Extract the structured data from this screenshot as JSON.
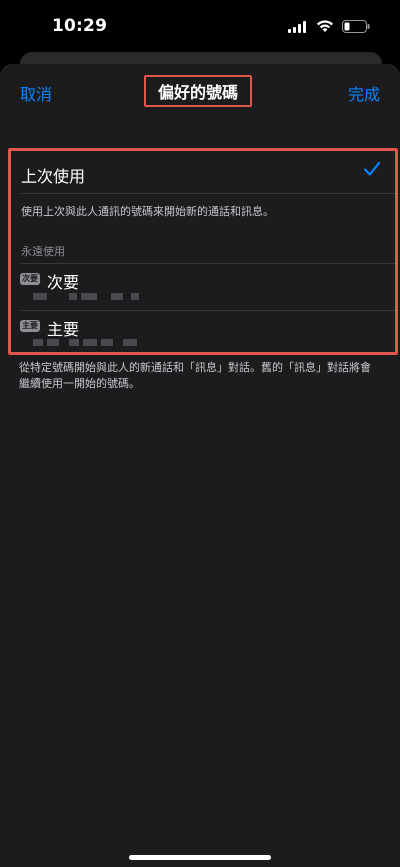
{
  "status_bar": {
    "time": "10:29"
  },
  "nav": {
    "cancel_label": "取消",
    "title": "偏好的號碼",
    "done_label": "完成"
  },
  "last_used": {
    "label": "上次使用",
    "description": "使用上次與此人通訊的號碼來開始新的通話和訊息。"
  },
  "always_use": {
    "header": "永遠使用",
    "items": [
      {
        "badge": "次要",
        "label": "次要"
      },
      {
        "badge": "主要",
        "label": "主要"
      }
    ]
  },
  "footer_text": "從特定號碼開始與此人的新通話和「訊息」對話。舊的「訊息」對話將會繼續使用一開始的號碼。",
  "colors": {
    "accent": "#0a84ff",
    "highlight_border": "#e2574c",
    "sheet_bg": "#1c1c1e"
  }
}
